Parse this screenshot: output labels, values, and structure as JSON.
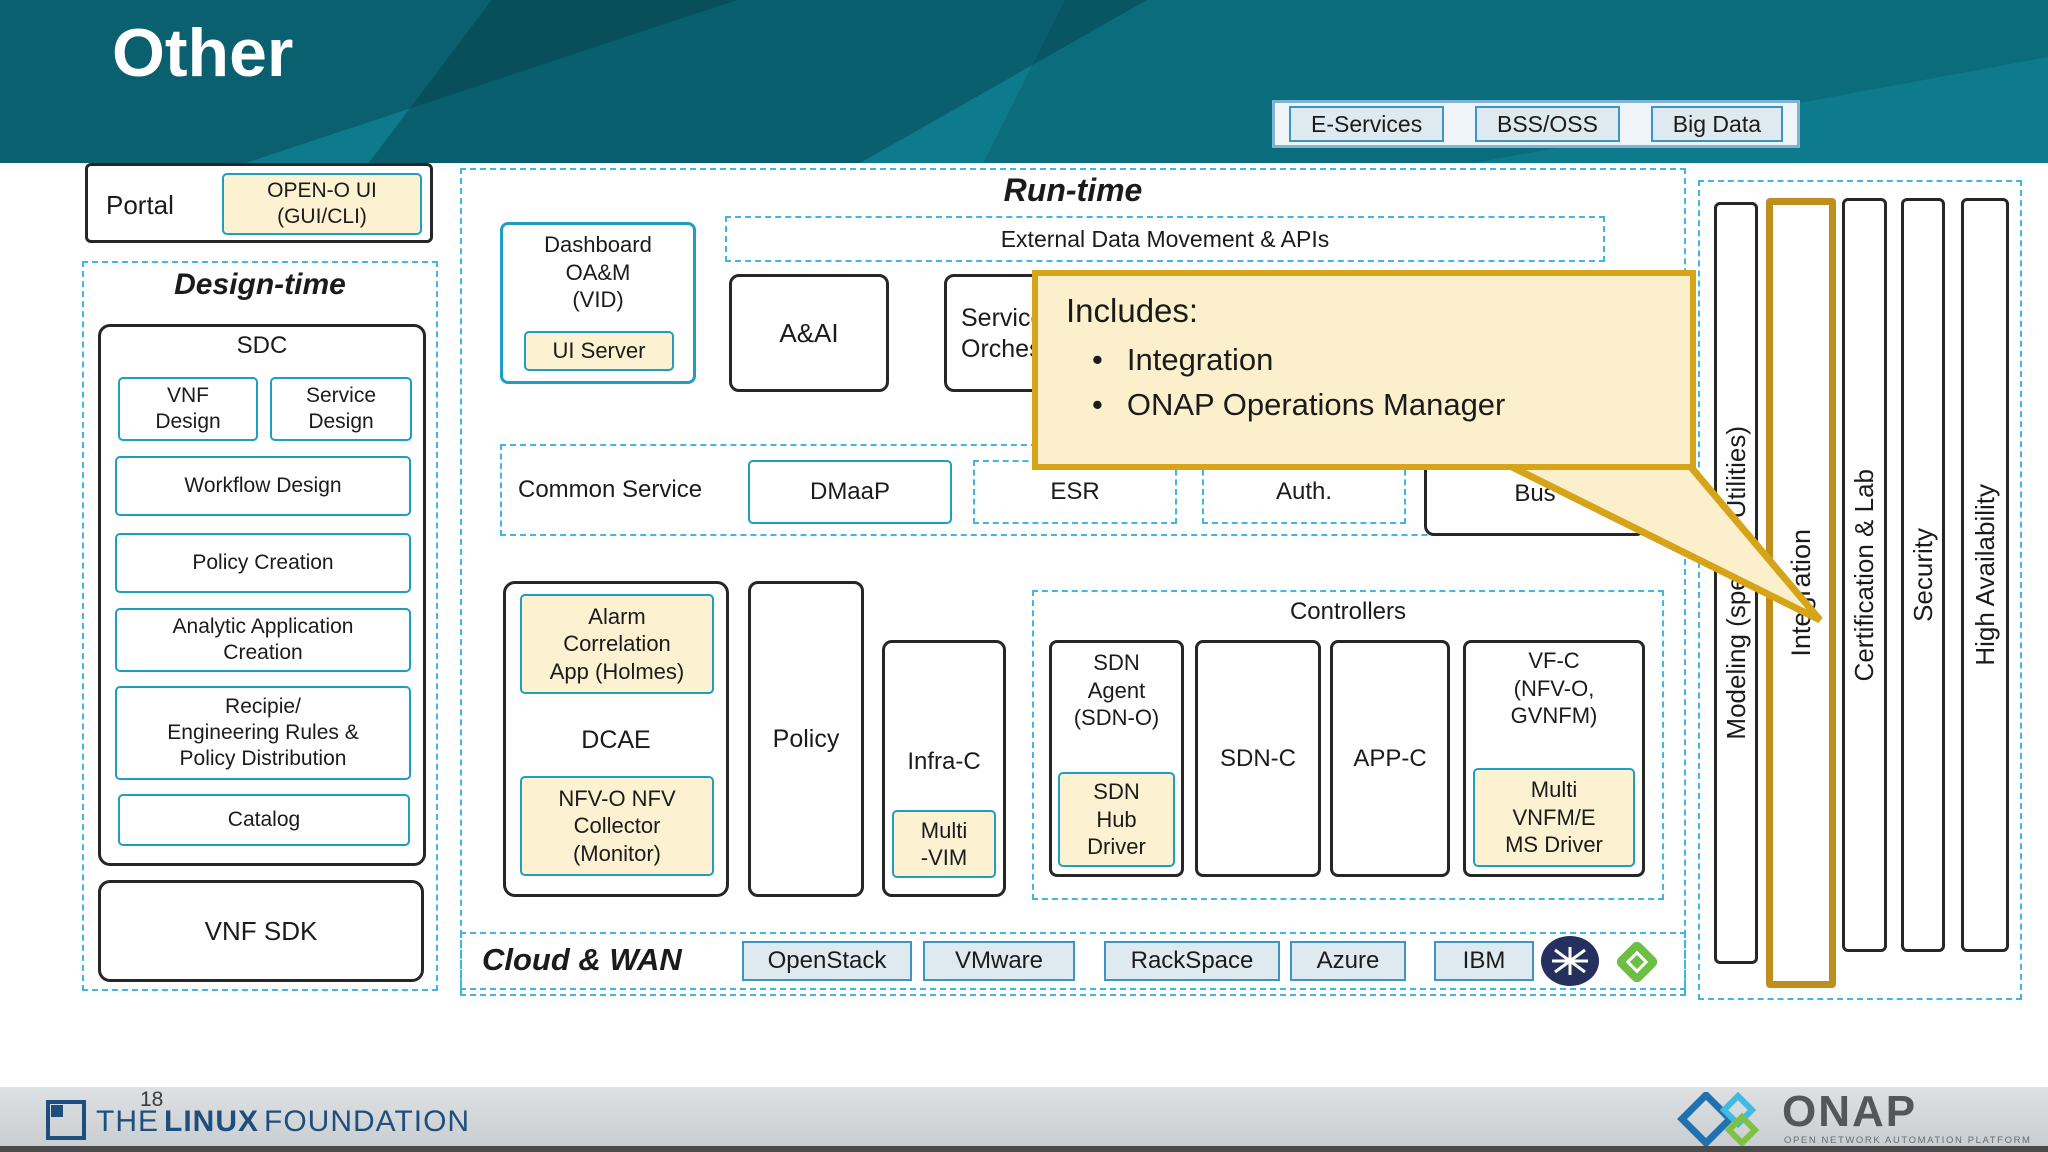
{
  "colors": {
    "header_teal": "#0E7B8D",
    "header_dark_teal": "#0A606F",
    "box_teal_border": "#1E9FC2",
    "highlight_cream": "#FCF2D2",
    "callout_gold": "#D6A419",
    "callout_cream": "#FCF0CC",
    "dashed_blue": "#41B6E2",
    "button_blue_border": "#3F94C6",
    "footer_gray": "#D7DADC",
    "linux_blue": "#1D4E7E"
  },
  "icons": [
    "juniper-network-icon",
    "green-cube-icon",
    "linux-foundation-icon",
    "onap-diamonds-icon"
  ],
  "header": {
    "title": "Other"
  },
  "top_buttons": {
    "items": [
      "E-Services",
      "BSS/OSS",
      "Big Data"
    ]
  },
  "portal": {
    "label": "Portal",
    "open_o_ui": "OPEN-O UI\n(GUI/CLI)"
  },
  "design_time": {
    "title": "Design-time",
    "sdc_title": "SDC",
    "vnf_design": "VNF\nDesign",
    "service_design": "Service\nDesign",
    "workflow_design": "Workflow Design",
    "policy_creation": "Policy Creation",
    "analytic_app": "Analytic Application\nCreation",
    "recipie": "Recipie/\nEngineering Rules &\nPolicy Distribution",
    "catalog": "Catalog",
    "vnf_sdk": "VNF SDK"
  },
  "run_time": {
    "title": "Run-time",
    "external_apis": "External Data Movement & APIs",
    "dashboard_title": "Dashboard\nOA&M\n(VID)",
    "ui_server": "UI Server",
    "aai": "A&AI",
    "service_orchestration": "Service\nOrchestration",
    "common_service_label": "Common Service",
    "dmaap": "DMaaP",
    "esr": "ESR",
    "auth": "Auth.",
    "bus": "Bus",
    "dcae_title": "DCAE",
    "alarm_app": "Alarm\nCorrelation\nApp (Holmes)",
    "nfv_collector": "NFV-O NFV\nCollector\n(Monitor)",
    "policy": "Policy",
    "infra_c": "Infra-C",
    "multi_vim": "Multi\n-VIM",
    "controllers_title": "Controllers",
    "sdn_agent": "SDN\nAgent\n(SDN-O)",
    "sdn_hub_driver": "SDN\nHub\nDriver",
    "sdn_c": "SDN-C",
    "app_c": "APP-C",
    "vf_c": "VF-C\n(NFV-O,\nGVNFM)",
    "multi_vnfm": "Multi\nVNFM/E\nMS Driver"
  },
  "callout": {
    "heading": "Includes:",
    "bullet_char": "•",
    "bullets": [
      "Integration",
      "ONAP Operations Manager"
    ]
  },
  "cloud_wan": {
    "title": "Cloud & WAN",
    "providers": [
      "OpenStack",
      "VMware",
      "RackSpace",
      "Azure",
      "IBM"
    ]
  },
  "right_bars": {
    "modeling": "Modeling (specs & Utilities)",
    "integration": "Integration",
    "certification": "Certification & Lab",
    "security": "Security",
    "high_availability": "High Availability"
  },
  "footer": {
    "page_number": "18",
    "lf_the": "THE",
    "lf_linux": "LINUX",
    "lf_foundation": "FOUNDATION",
    "onap_name": "ONAP",
    "onap_tagline": "OPEN NETWORK AUTOMATION PLATFORM"
  }
}
